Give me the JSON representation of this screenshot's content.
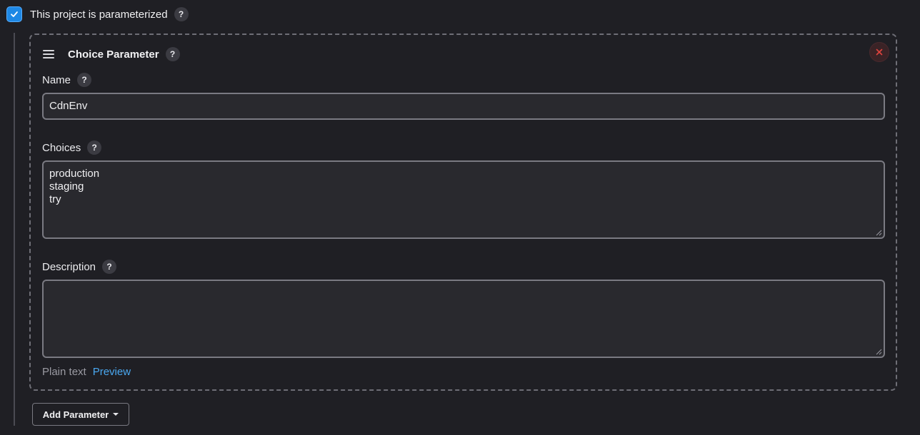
{
  "parameterized": {
    "label": "This project is parameterized",
    "checked": true,
    "help": "?"
  },
  "parameter": {
    "title": "Choice Parameter",
    "help": "?",
    "name_field": {
      "label": "Name",
      "help": "?",
      "value": "CdnEnv"
    },
    "choices_field": {
      "label": "Choices",
      "help": "?",
      "lines": [
        "production",
        "staging",
        "try"
      ]
    },
    "description_field": {
      "label": "Description",
      "help": "?",
      "value": "",
      "format_label": "Plain text",
      "preview_label": "Preview"
    }
  },
  "add_parameter": {
    "label": "Add Parameter"
  },
  "icons": {
    "checkbox": "check-icon",
    "drag": "drag-handle-icon",
    "close": "close-icon",
    "caret": "caret-down-icon"
  },
  "colors": {
    "accent": "#1e88e5",
    "link": "#4aa8f0",
    "close": "#e0443e",
    "background": "#1f1f24"
  }
}
